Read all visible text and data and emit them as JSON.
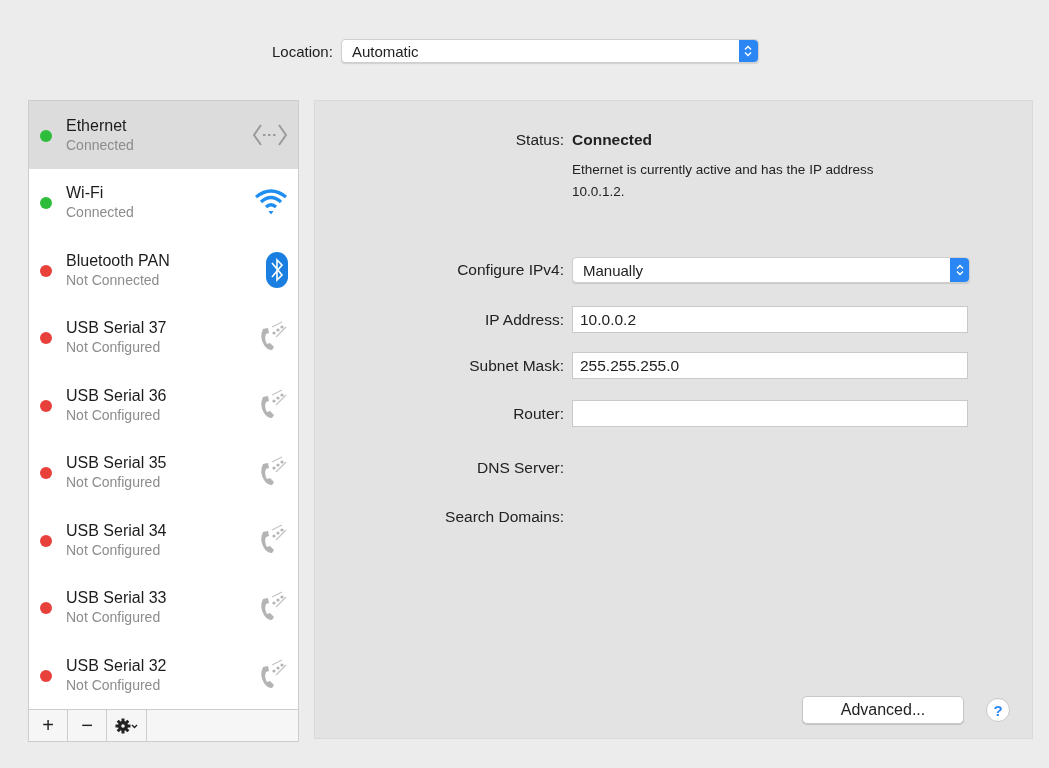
{
  "location": {
    "label": "Location:",
    "value": "Automatic"
  },
  "services": [
    {
      "name": "Ethernet",
      "status": "Connected",
      "color": "#2dbd3a",
      "kind": "ethernet",
      "selected": true
    },
    {
      "name": "Wi-Fi",
      "status": "Connected",
      "color": "#2dbd3a",
      "kind": "wifi",
      "selected": false
    },
    {
      "name": "Bluetooth PAN",
      "status": "Not Connected",
      "color": "#e8413c",
      "kind": "bluetooth",
      "selected": false
    },
    {
      "name": "USB Serial 37",
      "status": "Not Configured",
      "color": "#e8413c",
      "kind": "serial",
      "selected": false
    },
    {
      "name": "USB Serial 36",
      "status": "Not Configured",
      "color": "#e8413c",
      "kind": "serial",
      "selected": false
    },
    {
      "name": "USB Serial 35",
      "status": "Not Configured",
      "color": "#e8413c",
      "kind": "serial",
      "selected": false
    },
    {
      "name": "USB Serial 34",
      "status": "Not Configured",
      "color": "#e8413c",
      "kind": "serial",
      "selected": false
    },
    {
      "name": "USB Serial 33",
      "status": "Not Configured",
      "color": "#e8413c",
      "kind": "serial",
      "selected": false
    },
    {
      "name": "USB Serial 32",
      "status": "Not Configured",
      "color": "#e8413c",
      "kind": "serial",
      "selected": false
    }
  ],
  "list_toolbar": {
    "add": "+",
    "remove": "−"
  },
  "status": {
    "label": "Status:",
    "value": "Connected",
    "description": "Ethernet is currently active and has the IP address 10.0.1.2."
  },
  "settings": [
    {
      "label": "Configure IPv4:",
      "kind": "popup",
      "value": "Manually"
    },
    {
      "label": "IP Address:",
      "kind": "field",
      "value": "10.0.0.2"
    },
    {
      "label": "Subnet Mask:",
      "kind": "field",
      "value": "255.255.255.0"
    },
    {
      "label": "Router:",
      "kind": "field"
    },
    {
      "label": "DNS Server:",
      "kind": "plain"
    },
    {
      "label": "Search Domains:",
      "kind": "plain"
    }
  ],
  "advanced_button": "Advanced...",
  "help_button": "?"
}
